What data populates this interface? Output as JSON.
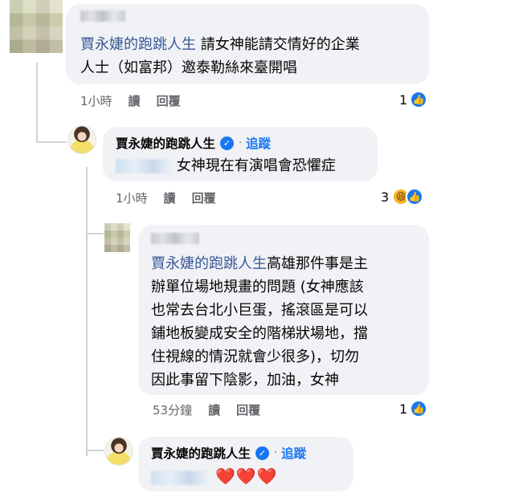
{
  "comments": [
    {
      "author": "",
      "tag": "賈永婕的跑跳人生",
      "text_line1": " 請女神能請交情好的企業",
      "text_line2": "人士（如富邦）邀泰勒絲來臺開唱",
      "time": "1小時",
      "read": "讀",
      "reply": "回覆",
      "count": "1",
      "reactions": [
        "like-icon"
      ]
    },
    {
      "author": "賈永婕的跑跳人生",
      "verified_icon": "check-icon",
      "dot": "·",
      "follow": "追蹤",
      "tag": "",
      "text": "女神現在有演唱會恐懼症",
      "time": "1小時",
      "read": "讀",
      "reply": "回覆",
      "count": "3",
      "reactions": [
        "haha-icon",
        "like-icon"
      ]
    },
    {
      "author": "",
      "tag": "賈永婕的跑跳人生",
      "text_line1": "高雄那件事是主",
      "text_line2": "辦單位場地規畫的問題 (女神應該",
      "text_line3": "也常去台北小巨蛋，搖滾區是可以",
      "text_line4": "鋪地板變成安全的階梯狀場地，擋",
      "text_line5": "住視線的情況就會少很多)，切勿",
      "text_line6": "因此事留下陰影，加油，女神",
      "time": "53分鐘",
      "read": "讀",
      "reply": "回覆",
      "count": "1",
      "reactions": [
        "like-icon"
      ]
    },
    {
      "author": "賈永婕的跑跳人生",
      "verified_icon": "check-icon",
      "dot": "·",
      "follow": "追蹤",
      "tag": "",
      "text": "❤️❤️❤️"
    }
  ],
  "colors": {
    "bubble": "#f0f2f5",
    "link": "#385898",
    "accent": "#1877f2",
    "meta": "#65676b",
    "heart": "#e41e3f"
  }
}
